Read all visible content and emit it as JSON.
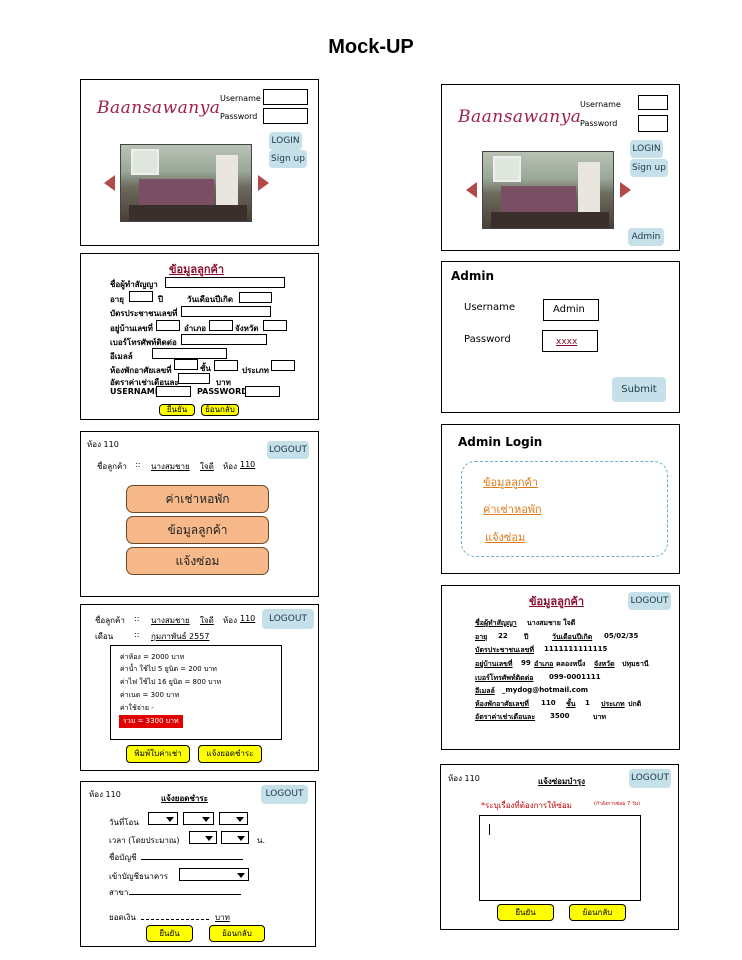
{
  "page_title": "Mock-UP",
  "login1": {
    "logo": "Baansawanya",
    "username_label": "Username",
    "password_label": "Password",
    "login_button": "LOGIN",
    "signup_button": "Sign up"
  },
  "login2": {
    "logo": "Baansawanya",
    "username_label": "Username",
    "password_label": "Password",
    "login_button": "LOGIN",
    "signup_button": "Sign up",
    "admin_button": "Admin"
  },
  "register": {
    "heading": "ข้อมูลลูกค้า",
    "f_name": "ชื่อผู้ทำสัญญา",
    "f_age": "อายุ",
    "f_years": "ปี",
    "f_birth": "วันเดือนปีเกิด",
    "f_id": "บัตรประชาชนเลขที่",
    "f_addr": "อยู่บ้านเลขที่",
    "f_district": "อำเภอ",
    "f_province": "จังหวัด",
    "f_phone": "เบอร์โทรศัพท์ติดต่อ",
    "f_email": "อีเมลล์",
    "f_room": "ห้องพักอาศัยเลขที่",
    "f_floor": "ชั้น",
    "f_type": "ประเภท",
    "f_rent": "อัตราค่าเช่าเดือนละ",
    "f_baht": "บาท",
    "f_username": "USERNAME",
    "f_password": "PASSWORD",
    "confirm": "ยืนยัน",
    "back": "ย้อนกลับ"
  },
  "admin": {
    "heading": "Admin",
    "username_label": "Username",
    "username_value": "Admin",
    "password_label": "Password",
    "password_value": "xxxx",
    "submit": "Submit"
  },
  "menu": {
    "room": "ห้อง 110",
    "logout": "LOGOUT",
    "customer_label": "ชื่อลูกค้า",
    "sep": "::",
    "customer_name": "นางสมชาย",
    "customer_surname": "ใจดี",
    "room_label": "ห้อง",
    "room_no": "110",
    "btn_rent": "ค่าเช่าหอพัก",
    "btn_info": "ข้อมูลลูกค้า",
    "btn_repair": "แจ้งซ่อม"
  },
  "admin_login": {
    "heading": "Admin Login",
    "link_info": "ข้อมูลลูกค้า",
    "link_rent": "ค่าเช่าหอพัก",
    "link_repair": "แจ้งซ่อม"
  },
  "bill": {
    "customer_label": "ชื่อลูกค้า",
    "sep": "::",
    "customer_name": "นางสมชาย",
    "customer_surname": "ใจดี",
    "room_label": "ห้อง",
    "room_no": "110",
    "logout": "LOGOUT",
    "month_label": "เดือน",
    "month_value": "กุมภาพันธ์ 2557",
    "lines": [
      "ค่าห้อง  =  2000 บาท",
      "ค่าน้ำ  ใช้ไป  5 ยูนิต  =   200 บาท",
      "ค่าไฟ  ใช้ไป  16 ยูนิต  =   800 บาท",
      "ค่าเนต  =  300 บาท",
      "ค่าใช้จ่าย  -"
    ],
    "total": "รวม  =  3300 บาท",
    "print_button": "พิมพ์ใบค่าเช่า",
    "notify_button": "แจ้งยอดชำระ"
  },
  "customer_info": {
    "heading": "ข้อมูลลูกค้า",
    "logout": "LOGOUT",
    "name_label": "ชื่อผู้ทำสัญญา",
    "name_value": "นางสมชาย  ใจดี",
    "age_label": "อายุ",
    "age_value": "22",
    "years": "ปี",
    "birth_label": "วันเดือนปีเกิด",
    "birth_value": "05/02/35",
    "id_label": "บัตรประชาชนเลขที่",
    "id_value": "1111111111115",
    "addr_label": "อยู่บ้านเลขที่",
    "addr_no": "99",
    "district_label": "อำเภอ",
    "district_value": "คลองหนึ่ง",
    "province_label": "จังหวัด",
    "province_value": "ปทุมธานี",
    "phone_label": "เบอร์โทรศัพท์ติดต่อ",
    "phone_value": "099-0001111",
    "email_label": "อีเมลล์",
    "email_value": "_mydog@hotmail.com",
    "room_label": "ห้องพักอาศัยเลขที่",
    "room_value": "110",
    "floor_label": "ชั้น",
    "floor_value": "1",
    "type_label": "ประเภท",
    "type_value": "ปกติ",
    "rent_label": "อัตราค่าเช่าเดือนละ",
    "rent_value": "3500",
    "baht": "บาท"
  },
  "payment": {
    "room": "ห้อง 110",
    "heading": "แจ้งยอดชำระ",
    "logout": "LOGOUT",
    "date_label": "วันที่โอน",
    "time_label": "เวลา (โดยประมาณ)",
    "time_unit": "น.",
    "account_label": "ชื่อบัญชี",
    "bank_label": "เข้าบัญชีธนาคาร",
    "branch_label": "สาขา",
    "amount_label": "ยอดเงิน",
    "amount_unit": "บาท",
    "confirm": "ยืนยัน",
    "back": "ย้อนกลับ"
  },
  "repair": {
    "room": "ห้อง 110",
    "heading": "แจ้งซ่อมบำรุง",
    "logout": "LOGOUT",
    "instruction": "*ระบุเรื่องที่ต้องการให้ซ่อม",
    "instruction_note": "(กำลังการซ่อม 7 วัน)",
    "confirm": "ยืนยัน",
    "back": "ย้อนกลับ"
  }
}
